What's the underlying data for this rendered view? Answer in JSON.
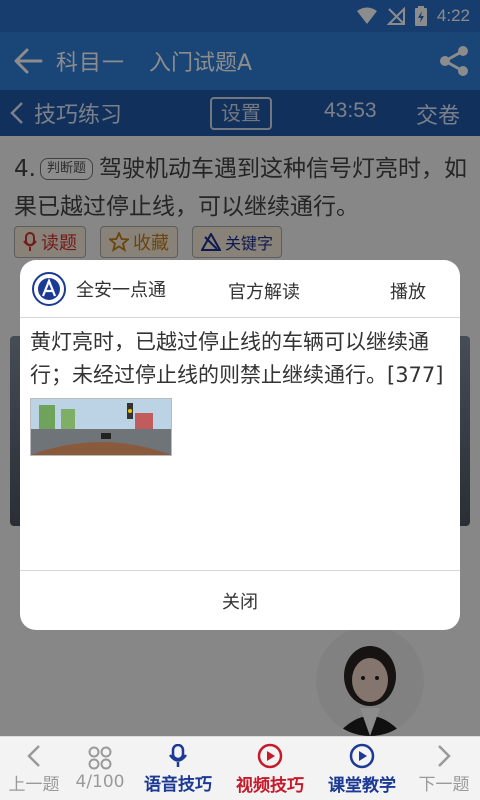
{
  "status": {
    "time": "4:22"
  },
  "appbar": {
    "title": "科目一",
    "subtitle": "入门试题A"
  },
  "toolbar": {
    "mode": "技巧练习",
    "settings_label": "设置",
    "timer": "43:53",
    "submit_label": "交卷"
  },
  "question": {
    "number": "4.",
    "type_tag": "判断题",
    "text": "驾驶机动车遇到这种信号灯亮时，如果已越过停止线，可以继续通行。"
  },
  "actions": {
    "read": "读题",
    "favorite": "收藏",
    "keyword": "关键字"
  },
  "dialog": {
    "brand": "全安一点通",
    "tab": "官方解读",
    "play": "播放",
    "body": "黄灯亮时，已越过停止线的车辆可以继续通行；未经过停止线的则禁止继续通行。[377]",
    "close": "关闭"
  },
  "bottom": {
    "prev": "上一题",
    "progress": "4/100",
    "voice": "语音技巧",
    "video": "视频技巧",
    "class": "课堂教学",
    "next": "下一题"
  },
  "colors": {
    "primary": "#2f7fd9",
    "dark_primary": "#1f5aa8",
    "accent_red": "#c61a2a",
    "accent_blue": "#1c3a95"
  }
}
